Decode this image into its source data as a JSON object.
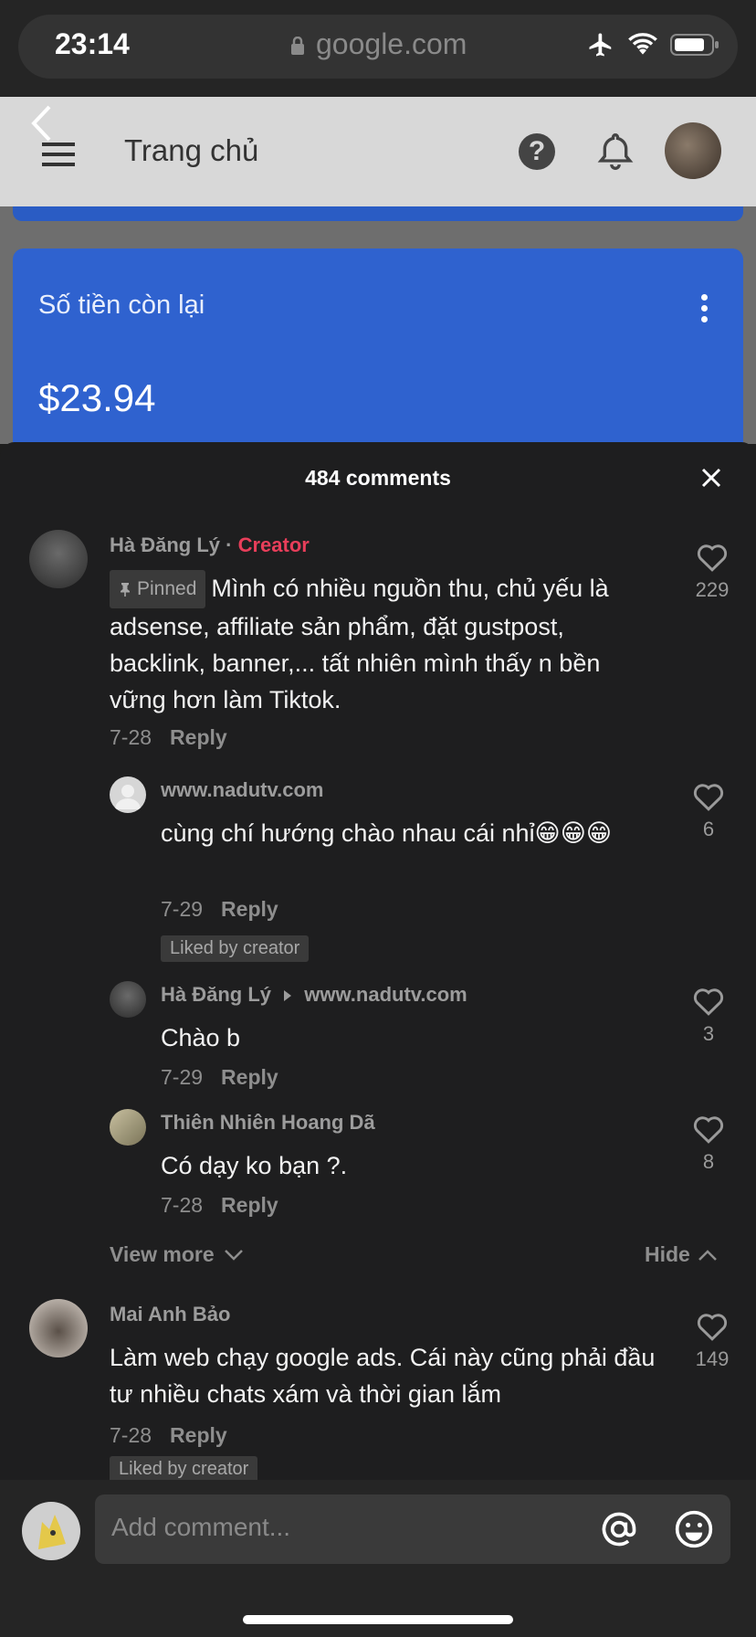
{
  "status_bar": {
    "time": "23:14",
    "url": "google.com"
  },
  "google_page": {
    "title": "Trang chủ",
    "card_label": "Số tiền còn lại",
    "card_amount": "$23.94",
    "accent": "#2f62cf"
  },
  "comments_sheet": {
    "title": "484 comments",
    "comments": [
      {
        "author": "Hà Đăng Lý",
        "author_sep": " · ",
        "creator_tag": "Creator",
        "pinned_label": "Pinned",
        "text": "Mình có nhiều nguồn thu, chủ yếu là adsense, affiliate sản phẩm, đặt gustpost, backlink, banner,... tất nhiên mình thấy n bền vững hơn làm Tiktok.",
        "date": "7-28",
        "reply_label": "Reply",
        "likes": "229"
      },
      {
        "author": "www.nadutv.com",
        "text": "cùng chí hướng chào nhau cái nhỉ😁😁😁",
        "date": "7-29",
        "reply_label": "Reply",
        "badge": "Liked by creator",
        "likes": "6"
      },
      {
        "author": "Hà Đăng Lý",
        "reply_to": "www.nadutv.com",
        "text": "Chào b",
        "date": "7-29",
        "reply_label": "Reply",
        "likes": "3"
      },
      {
        "author": "Thiên Nhiên Hoang Dã",
        "text": "Có dạy ko bạn ?.",
        "date": "7-28",
        "reply_label": "Reply",
        "likes": "8"
      },
      {
        "author": "Mai Anh Bảo",
        "text": "Làm web chạy google ads. Cái này cũng phải đầu tư nhiều chats xám và thời gian lắm",
        "date": "7-28",
        "reply_label": "Reply",
        "badge": "Liked by creator",
        "likes": "149"
      }
    ],
    "view_more": "View more",
    "hide": "Hide"
  },
  "input": {
    "placeholder": "Add comment..."
  },
  "colors": {
    "creator": "#e83e5a",
    "sheet_bg": "#1e1e1f"
  }
}
